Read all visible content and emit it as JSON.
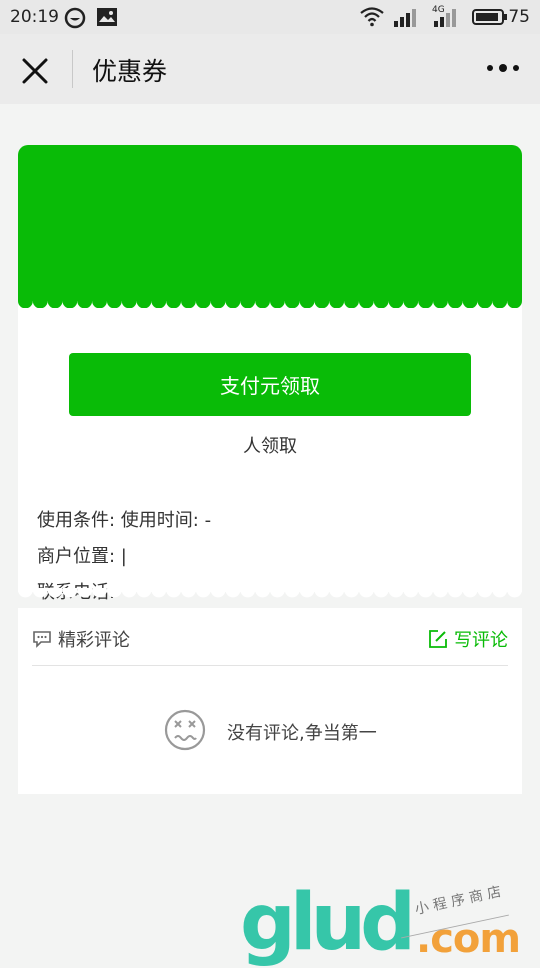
{
  "status_bar": {
    "time": "20:19",
    "battery": "75",
    "network_label": "4G"
  },
  "navbar": {
    "title": "优惠券",
    "close_icon": "close-icon",
    "more_icon": "more-icon"
  },
  "coupon": {
    "header_color": "#09bb07",
    "pay_button_label": "支付元领取",
    "claim_count_text": "人领取",
    "usage_line": "使用条件: 使用时间: -",
    "location_line": "商户位置: |",
    "phone_line": "联系电话:"
  },
  "comments": {
    "section_title": "精彩评论",
    "write_label": "写评论",
    "empty_text": "没有评论,争当第一",
    "accent_color": "#09bb07"
  },
  "watermark": {
    "main": "glud",
    "suffix": ".com",
    "sub": "小 程 序 商 店"
  }
}
